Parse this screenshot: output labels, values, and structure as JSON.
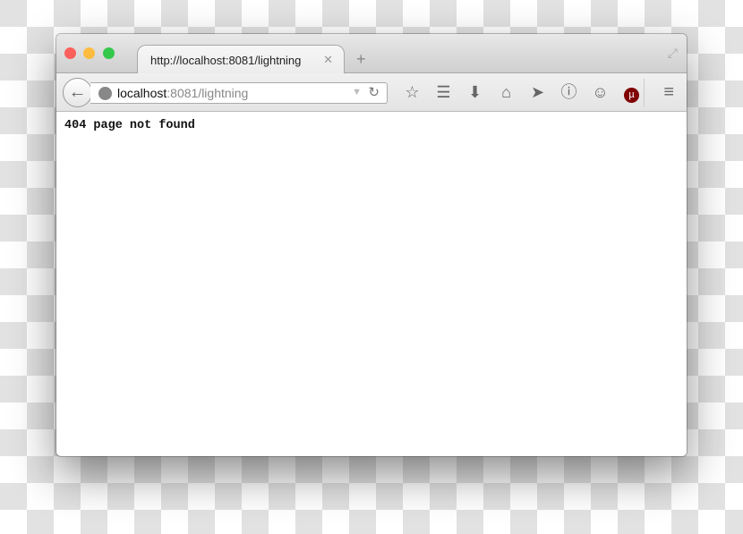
{
  "tab": {
    "title": "http://localhost:8081/lightning",
    "close": "✕",
    "new_tab": "+"
  },
  "urlbar": {
    "host": "localhost",
    "rest": ":8081/lightning"
  },
  "toolbar_icons": [
    "star-icon",
    "reading-list-icon",
    "download-icon",
    "home-icon",
    "send-icon",
    "password-manager-icon",
    "chat-icon",
    "ublock-icon",
    "menu-icon"
  ],
  "content": {
    "text": "404 page not found"
  },
  "colors": {
    "close": "#fc605c",
    "minimize": "#fdbc40",
    "maximize": "#34c84a",
    "ublock": "#800000"
  }
}
